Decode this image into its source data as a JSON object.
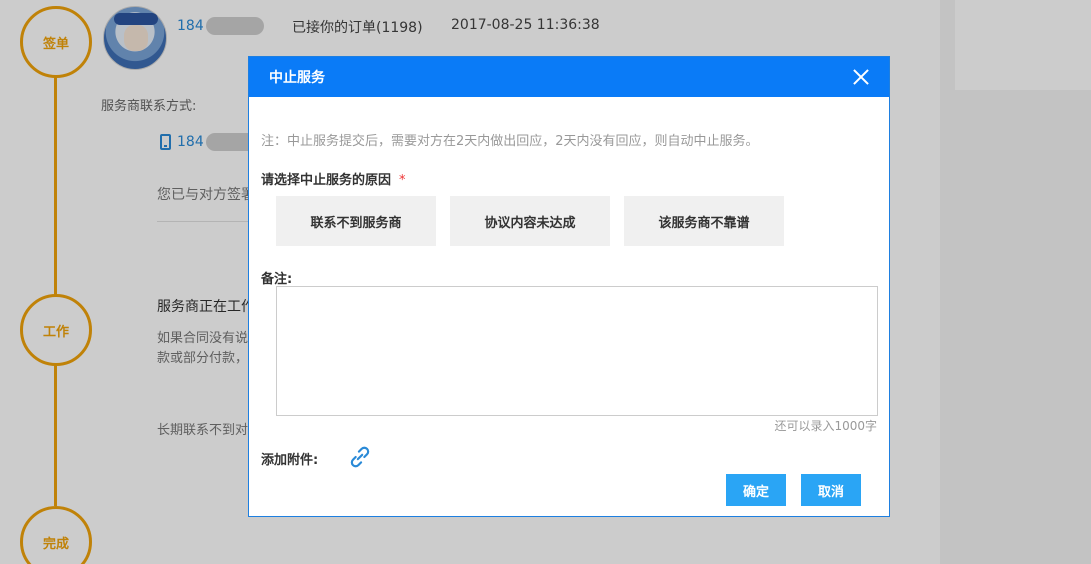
{
  "background": {
    "timeline": {
      "steps": [
        "签单",
        "工作",
        "完成"
      ]
    },
    "order": {
      "phone_prefix": "184",
      "status_text": "已接你的订单(1198)",
      "timestamp": "2017-08-25 11:36:38"
    },
    "contact": {
      "label": "服务商联系方式:",
      "phone_prefix": "184"
    },
    "signed_text": "您已与对方签署",
    "working": {
      "title": "服务商正在工作",
      "desc_line1": "如果合同没有说",
      "desc_line2": "款或部分付款，",
      "longterm_text": "长期联系不到对"
    }
  },
  "modal": {
    "title": "中止服务",
    "note": "注：中止服务提交后，需要对方在2天内做出回应，2天内没有回应，则自动中止服务。",
    "reason_label": "请选择中止服务的原因",
    "required_mark": "*",
    "reasons": [
      "联系不到服务商",
      "协议内容未达成",
      "该服务商不靠谱"
    ],
    "remark_label": "备注:",
    "remark_value": "",
    "char_count": "还可以录入1000字",
    "attach_label": "添加附件:",
    "buttons": {
      "ok": "确定",
      "cancel": "取消"
    }
  },
  "colors": {
    "accent_orange": "#f0a30a",
    "header_blue": "#0a7bf7",
    "button_blue": "#2aa5f5",
    "link_blue": "#2a8ad7"
  }
}
